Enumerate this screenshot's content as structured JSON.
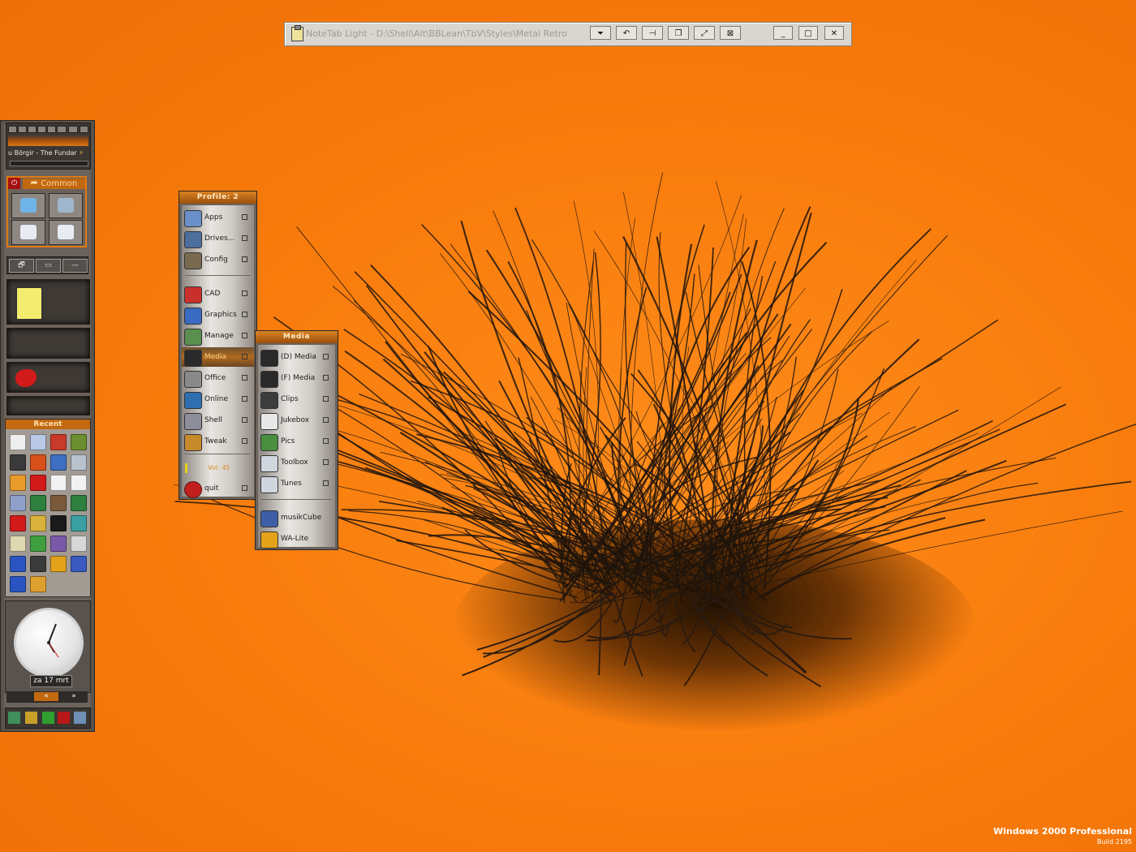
{
  "titlebar": {
    "title": "NoteTab Light  -  D:\\Shell\\Alt\\BBLean\\TbV\\Styles\\Metal Retro",
    "buttons": [
      "scroll-down",
      "undo",
      "pin",
      "copy",
      "expand",
      "shade",
      "minimize",
      "maximize",
      "close"
    ],
    "glyphs": [
      "⏷",
      "↶",
      "⊣",
      "❐",
      "⤢",
      "⊠",
      "_",
      "□",
      "✕"
    ]
  },
  "player": {
    "now_playing": "u Börgir - The Fundar",
    "bolt": "⚡"
  },
  "common": {
    "power": "⏻",
    "label": "⮫ Common"
  },
  "window_controls": [
    "🗗",
    "▭",
    "—"
  ],
  "recent": {
    "label": "Recent"
  },
  "clock": {
    "date": "za 17 mrt"
  },
  "pager": {
    "prev": "«",
    "next": "»"
  },
  "profile_menu": {
    "title": "Profile: 2",
    "items": [
      {
        "label": "Apps",
        "icon": "apps-icon",
        "color": "#6b8fc8"
      },
      {
        "label": "Drives...",
        "icon": "drive-icon",
        "color": "#4d6f9e"
      },
      {
        "label": "Config",
        "icon": "config-icon",
        "color": "#7a6a50"
      },
      {
        "label": "CAD",
        "icon": "cad-icon",
        "color": "#c9302c"
      },
      {
        "label": "Graphics",
        "icon": "graphics-icon",
        "color": "#3a6bc2"
      },
      {
        "label": "Manage",
        "icon": "manage-icon",
        "color": "#5a8f4f"
      },
      {
        "label": "Media",
        "icon": "film-reel-icon",
        "color": "#2a2a2a"
      },
      {
        "label": "Office",
        "icon": "office-icon",
        "color": "#8a8a8a"
      },
      {
        "label": "Online",
        "icon": "globe-icon",
        "color": "#2f6fb0"
      },
      {
        "label": "Shell",
        "icon": "shell-icon",
        "color": "#8e8e9a"
      },
      {
        "label": "Tweak",
        "icon": "tweak-icon",
        "color": "#c78a2a"
      }
    ],
    "volume": "Vol: 45",
    "quit": "quit"
  },
  "media_menu": {
    "title": "Media",
    "items": [
      {
        "label": "(D) Media",
        "icon": "film-reel-icon",
        "color": "#2a2a2a"
      },
      {
        "label": "(F) Media",
        "icon": "film-reel-icon",
        "color": "#2a2a2a"
      },
      {
        "label": "Clips",
        "icon": "clips-icon",
        "color": "#3c3c3c"
      },
      {
        "label": "Jukebox",
        "icon": "ipod-icon",
        "color": "#e8e8e8"
      },
      {
        "label": "Pics",
        "icon": "pics-icon",
        "color": "#4a8f3f"
      },
      {
        "label": "Toolbox",
        "icon": "folder-icon",
        "color": "#cfd6de"
      },
      {
        "label": "Tunes",
        "icon": "folder-icon",
        "color": "#cfd6de"
      },
      {
        "label": "musikCube",
        "icon": "musikcube-icon",
        "color": "#3e5fa8"
      },
      {
        "label": "WA-Lite",
        "icon": "winamp-icon",
        "color": "#e3a21a"
      }
    ]
  },
  "os_label": {
    "name": "Windows 2000 Professional",
    "build": "Build  2195"
  },
  "colors": {
    "desktop": "#f97a0c",
    "accent": "#c2680f",
    "menu_frame": "#6a625b"
  }
}
